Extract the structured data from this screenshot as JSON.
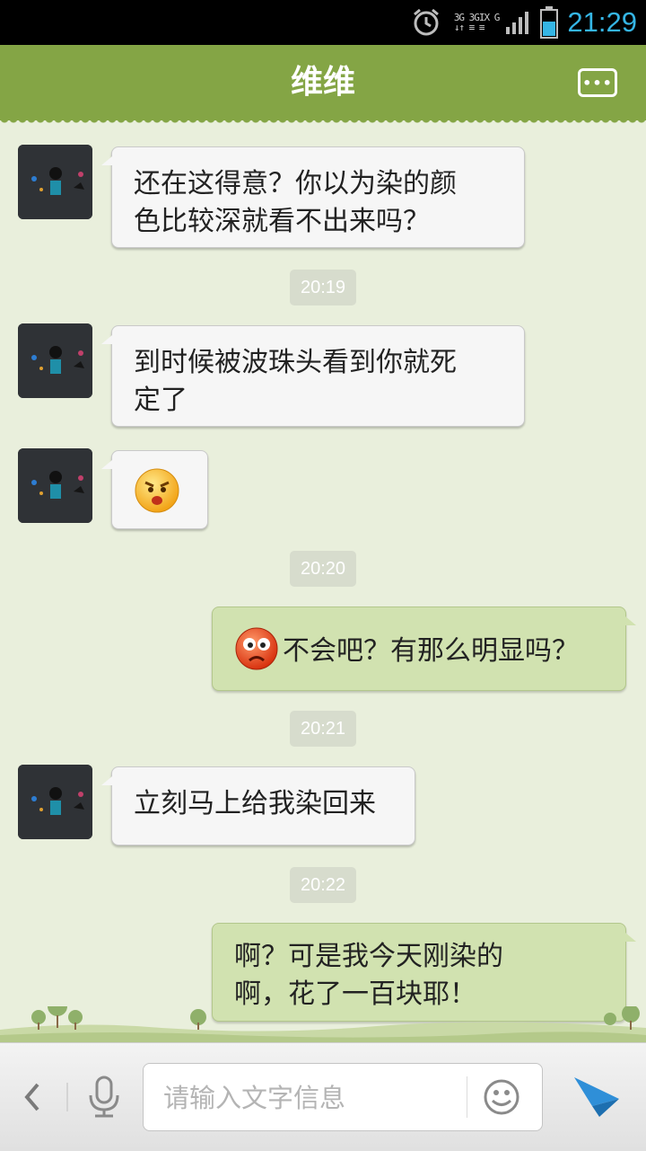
{
  "status_bar": {
    "network_line1": "3G 3GIX G",
    "network_line2": "↓↑ ≡ ≡",
    "clock": "21:29",
    "icons": [
      "alarm-icon",
      "signal-icon",
      "battery-icon"
    ]
  },
  "header": {
    "title": "维维",
    "menu_icon": "more-icon"
  },
  "messages": [
    {
      "from": "contact",
      "kind": "text",
      "lines": [
        "还在这得意？你以为染的颜",
        "色比较深就看不出来吗？"
      ]
    },
    {
      "kind": "time",
      "text": "20:19"
    },
    {
      "from": "contact",
      "kind": "text",
      "lines": [
        "到时候被波珠头看到你就死",
        "定了"
      ]
    },
    {
      "from": "contact",
      "kind": "emoji",
      "emoji": "angry-face-emoji"
    },
    {
      "kind": "time",
      "text": "20:20"
    },
    {
      "from": "me",
      "kind": "text",
      "emoji": "shocked-red-face-emoji",
      "lines": [
        "不会吧？有那么明显吗？"
      ]
    },
    {
      "kind": "time",
      "text": "20:21"
    },
    {
      "from": "contact",
      "kind": "text",
      "lines": [
        "立刻马上给我染回来"
      ]
    },
    {
      "kind": "time",
      "text": "20:22"
    },
    {
      "from": "me",
      "kind": "text",
      "lines": [
        "啊？可是我今天刚染的",
        "啊，花了一百块耶！"
      ]
    }
  ],
  "input_bar": {
    "placeholder": "请输入文字信息",
    "back_icon": "chevron-left-icon",
    "voice_icon": "microphone-icon",
    "emoji_icon": "smiley-icon",
    "send_icon": "send-icon"
  },
  "colors": {
    "header": "#84a545",
    "background": "#e9efdc",
    "incoming_bubble": "#f6f6f6",
    "outgoing_bubble": "#d1e2b0",
    "clock": "#35b5e5",
    "send": "#2f8fd8"
  }
}
